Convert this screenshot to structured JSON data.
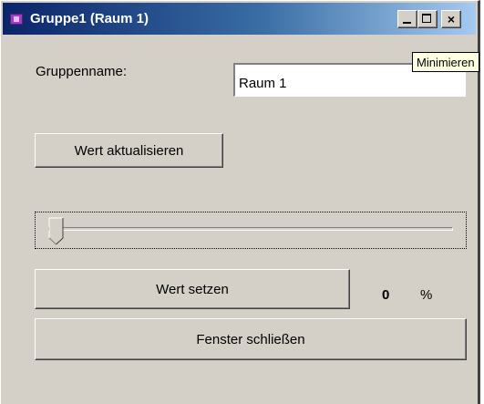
{
  "window": {
    "title": "Gruppe1 (Raum 1)",
    "icon": "app-icon",
    "controls": {
      "minimize": "minimize-icon",
      "maximize": "maximize-icon",
      "close_glyph": "×"
    }
  },
  "tooltip": {
    "text": "Minimieren"
  },
  "form": {
    "group_name_label": "Gruppenname:",
    "group_name_value": "Raum 1",
    "refresh_button": "Wert aktualisieren",
    "slider": {
      "value_percent": 0
    },
    "set_button": "Wert setzen",
    "value_display": "0",
    "value_unit": "%",
    "close_button": "Fenster schließen"
  },
  "colors": {
    "face": "#d4d0c8",
    "titlebar_start": "#0a246a",
    "titlebar_end": "#a6caf0",
    "tooltip_bg": "#ffffe1"
  }
}
